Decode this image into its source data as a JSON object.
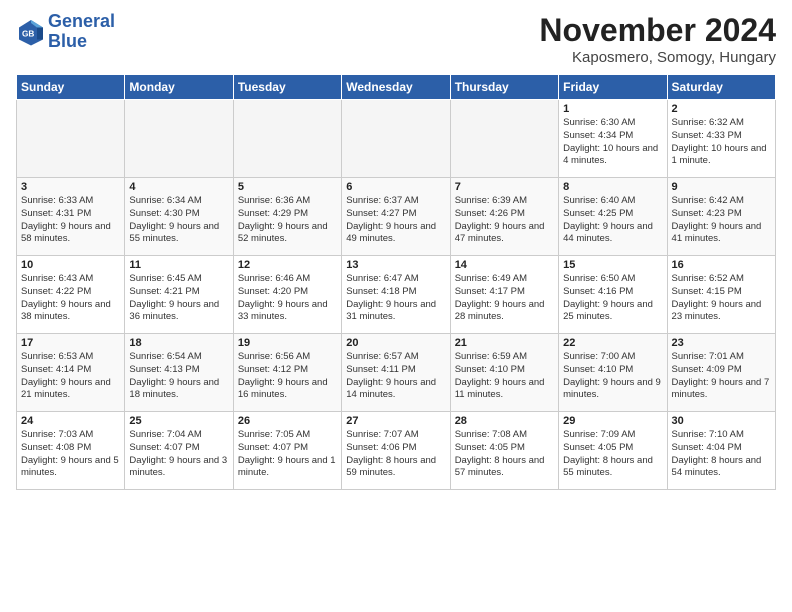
{
  "logo": {
    "line1": "General",
    "line2": "Blue"
  },
  "title": "November 2024",
  "location": "Kaposmero, Somogy, Hungary",
  "weekdays": [
    "Sunday",
    "Monday",
    "Tuesday",
    "Wednesday",
    "Thursday",
    "Friday",
    "Saturday"
  ],
  "weeks": [
    [
      {
        "day": "",
        "empty": true
      },
      {
        "day": "",
        "empty": true
      },
      {
        "day": "",
        "empty": true
      },
      {
        "day": "",
        "empty": true
      },
      {
        "day": "",
        "empty": true
      },
      {
        "day": "1",
        "sunrise": "6:30 AM",
        "sunset": "4:34 PM",
        "daylight": "10 hours and 4 minutes."
      },
      {
        "day": "2",
        "sunrise": "6:32 AM",
        "sunset": "4:33 PM",
        "daylight": "10 hours and 1 minute."
      }
    ],
    [
      {
        "day": "3",
        "sunrise": "6:33 AM",
        "sunset": "4:31 PM",
        "daylight": "9 hours and 58 minutes."
      },
      {
        "day": "4",
        "sunrise": "6:34 AM",
        "sunset": "4:30 PM",
        "daylight": "9 hours and 55 minutes."
      },
      {
        "day": "5",
        "sunrise": "6:36 AM",
        "sunset": "4:29 PM",
        "daylight": "9 hours and 52 minutes."
      },
      {
        "day": "6",
        "sunrise": "6:37 AM",
        "sunset": "4:27 PM",
        "daylight": "9 hours and 49 minutes."
      },
      {
        "day": "7",
        "sunrise": "6:39 AM",
        "sunset": "4:26 PM",
        "daylight": "9 hours and 47 minutes."
      },
      {
        "day": "8",
        "sunrise": "6:40 AM",
        "sunset": "4:25 PM",
        "daylight": "9 hours and 44 minutes."
      },
      {
        "day": "9",
        "sunrise": "6:42 AM",
        "sunset": "4:23 PM",
        "daylight": "9 hours and 41 minutes."
      }
    ],
    [
      {
        "day": "10",
        "sunrise": "6:43 AM",
        "sunset": "4:22 PM",
        "daylight": "9 hours and 38 minutes."
      },
      {
        "day": "11",
        "sunrise": "6:45 AM",
        "sunset": "4:21 PM",
        "daylight": "9 hours and 36 minutes."
      },
      {
        "day": "12",
        "sunrise": "6:46 AM",
        "sunset": "4:20 PM",
        "daylight": "9 hours and 33 minutes."
      },
      {
        "day": "13",
        "sunrise": "6:47 AM",
        "sunset": "4:18 PM",
        "daylight": "9 hours and 31 minutes."
      },
      {
        "day": "14",
        "sunrise": "6:49 AM",
        "sunset": "4:17 PM",
        "daylight": "9 hours and 28 minutes."
      },
      {
        "day": "15",
        "sunrise": "6:50 AM",
        "sunset": "4:16 PM",
        "daylight": "9 hours and 25 minutes."
      },
      {
        "day": "16",
        "sunrise": "6:52 AM",
        "sunset": "4:15 PM",
        "daylight": "9 hours and 23 minutes."
      }
    ],
    [
      {
        "day": "17",
        "sunrise": "6:53 AM",
        "sunset": "4:14 PM",
        "daylight": "9 hours and 21 minutes."
      },
      {
        "day": "18",
        "sunrise": "6:54 AM",
        "sunset": "4:13 PM",
        "daylight": "9 hours and 18 minutes."
      },
      {
        "day": "19",
        "sunrise": "6:56 AM",
        "sunset": "4:12 PM",
        "daylight": "9 hours and 16 minutes."
      },
      {
        "day": "20",
        "sunrise": "6:57 AM",
        "sunset": "4:11 PM",
        "daylight": "9 hours and 14 minutes."
      },
      {
        "day": "21",
        "sunrise": "6:59 AM",
        "sunset": "4:10 PM",
        "daylight": "9 hours and 11 minutes."
      },
      {
        "day": "22",
        "sunrise": "7:00 AM",
        "sunset": "4:10 PM",
        "daylight": "9 hours and 9 minutes."
      },
      {
        "day": "23",
        "sunrise": "7:01 AM",
        "sunset": "4:09 PM",
        "daylight": "9 hours and 7 minutes."
      }
    ],
    [
      {
        "day": "24",
        "sunrise": "7:03 AM",
        "sunset": "4:08 PM",
        "daylight": "9 hours and 5 minutes."
      },
      {
        "day": "25",
        "sunrise": "7:04 AM",
        "sunset": "4:07 PM",
        "daylight": "9 hours and 3 minutes."
      },
      {
        "day": "26",
        "sunrise": "7:05 AM",
        "sunset": "4:07 PM",
        "daylight": "9 hours and 1 minute."
      },
      {
        "day": "27",
        "sunrise": "7:07 AM",
        "sunset": "4:06 PM",
        "daylight": "8 hours and 59 minutes."
      },
      {
        "day": "28",
        "sunrise": "7:08 AM",
        "sunset": "4:05 PM",
        "daylight": "8 hours and 57 minutes."
      },
      {
        "day": "29",
        "sunrise": "7:09 AM",
        "sunset": "4:05 PM",
        "daylight": "8 hours and 55 minutes."
      },
      {
        "day": "30",
        "sunrise": "7:10 AM",
        "sunset": "4:04 PM",
        "daylight": "8 hours and 54 minutes."
      }
    ]
  ]
}
